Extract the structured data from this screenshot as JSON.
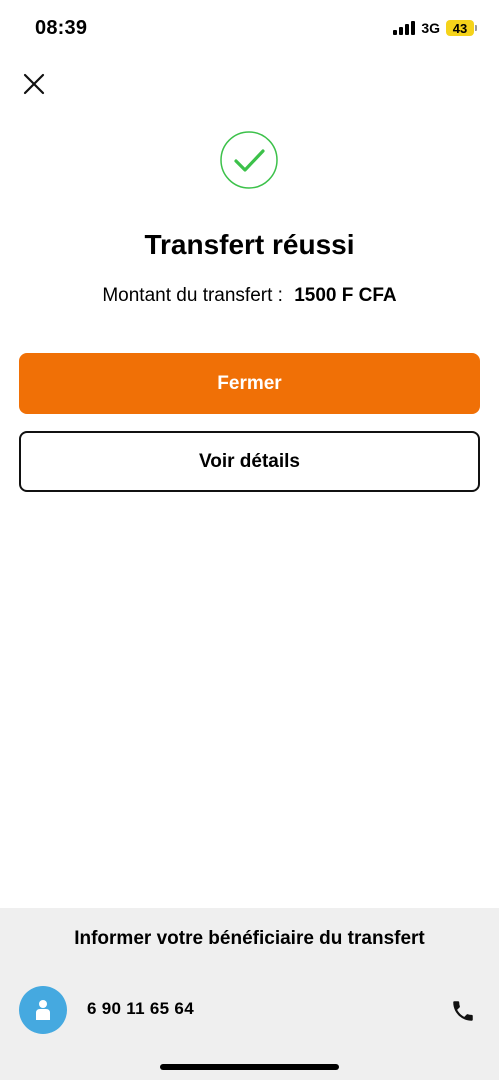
{
  "status_bar": {
    "time": "08:39",
    "network": "3G",
    "battery": "43",
    "icons": [
      "signal-icon",
      "battery-icon"
    ]
  },
  "header": {
    "close_icon": "close-icon"
  },
  "result": {
    "icon": "check-circle-icon",
    "title": "Transfert réussi",
    "amount_label": "Montant du transfert :",
    "amount_value": "1500 F CFA"
  },
  "actions": {
    "primary_label": "Fermer",
    "secondary_label": "Voir détails"
  },
  "inform": {
    "title": "Informer votre bénéficiaire du transfert",
    "phone": "6 90 11 65 64",
    "avatar_icon": "person-icon",
    "call_icon": "phone-icon"
  },
  "colors": {
    "accent": "#f07006",
    "success": "#3cc14a",
    "avatar": "#45a9e0",
    "panel": "#efefef",
    "battery": "#f5d31a"
  }
}
